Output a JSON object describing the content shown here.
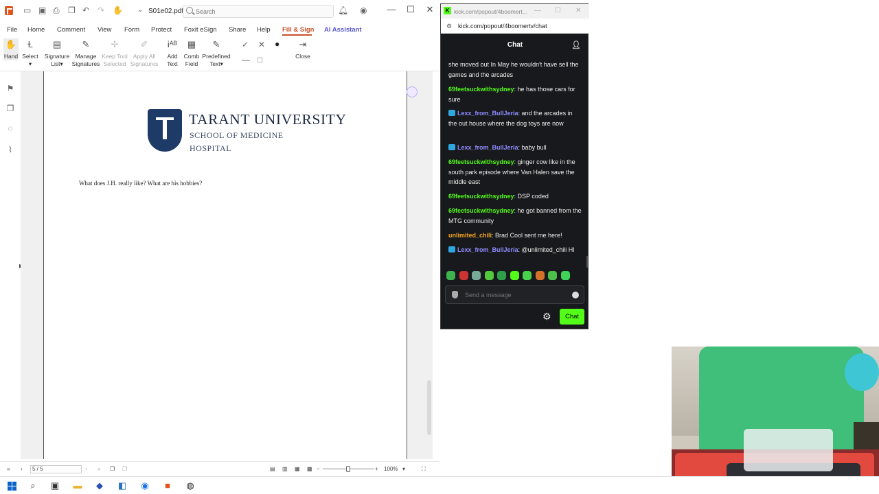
{
  "pdf": {
    "document_title": "S01e02.pdf *",
    "search_placeholder": "Search",
    "menu": [
      "File",
      "Home",
      "Comment",
      "View",
      "Form",
      "Protect",
      "Foxit eSign",
      "Share",
      "Help",
      "Fill & Sign",
      "AI Assistant"
    ],
    "ribbon": {
      "hand": "Hand",
      "select": "Select",
      "signature_list_1": "Signature",
      "signature_list_2": "List",
      "manage_signatures_1": "Manage",
      "manage_signatures_2": "Signatures",
      "keep_tool_1": "Keep Tool",
      "keep_tool_2": "Selected",
      "apply_all_1": "Apply All",
      "apply_all_2": "Signatures",
      "add_text_1": "Add",
      "add_text_2": "Text",
      "comb_field_1": "Comb",
      "comb_field_2": "Field",
      "predefined_1": "Predefined",
      "predefined_2": "Text",
      "close": "Close"
    },
    "page": {
      "university": "TARANT UNIVERSITY",
      "school": "SCHOOL OF MEDICINE",
      "hospital": "HOSPITAL",
      "question": "What does J.H. really like? What are his hobbies?"
    },
    "status": {
      "page_indicator": "5 / 5",
      "zoom": "100%"
    }
  },
  "chat": {
    "window_title": "kick.com/popout/4boomert...",
    "url": "kick.com/popout/4boomertv/chat",
    "header": "Chat",
    "messages": [
      {
        "user": "",
        "text": "she moved out In May he wouldn't have sell the games and the arcades",
        "badge": false
      },
      {
        "user": "69feetsuckwithsydney",
        "text": ": he has those cars for sure",
        "badge": false
      },
      {
        "user": "Lexx_from_BullJeria",
        "text": ": and the arcades in the out house where the dog toys are now",
        "badge": true
      },
      {
        "user": "Lexx_from_BullJeria",
        "text": ": baby bull",
        "badge": true
      },
      {
        "user": "69feetsuckwithsydney",
        "text": ": ginger cow like in the south park episode where Van Halen save the middle east",
        "badge": false
      },
      {
        "user": "69feetsuckwithsydney",
        "text": ": DSP coded",
        "badge": false
      },
      {
        "user": "69feetsuckwithsydney",
        "text": ": he got banned from the MTG community",
        "badge": false
      },
      {
        "user": "unlimited_chili",
        "text": ": Brad Cool sent me here!",
        "badge": false
      },
      {
        "user": "Lexx_from_BullJeria",
        "text": ": @unlimited_chili HI",
        "badge": true
      }
    ],
    "input_placeholder": "Send a message",
    "send_label": "Chat",
    "colors": {
      "green_user": "#53fc18",
      "blue_user": "#8f8cff",
      "orange_user": "#f5a623",
      "accent": "#53fc18"
    }
  }
}
